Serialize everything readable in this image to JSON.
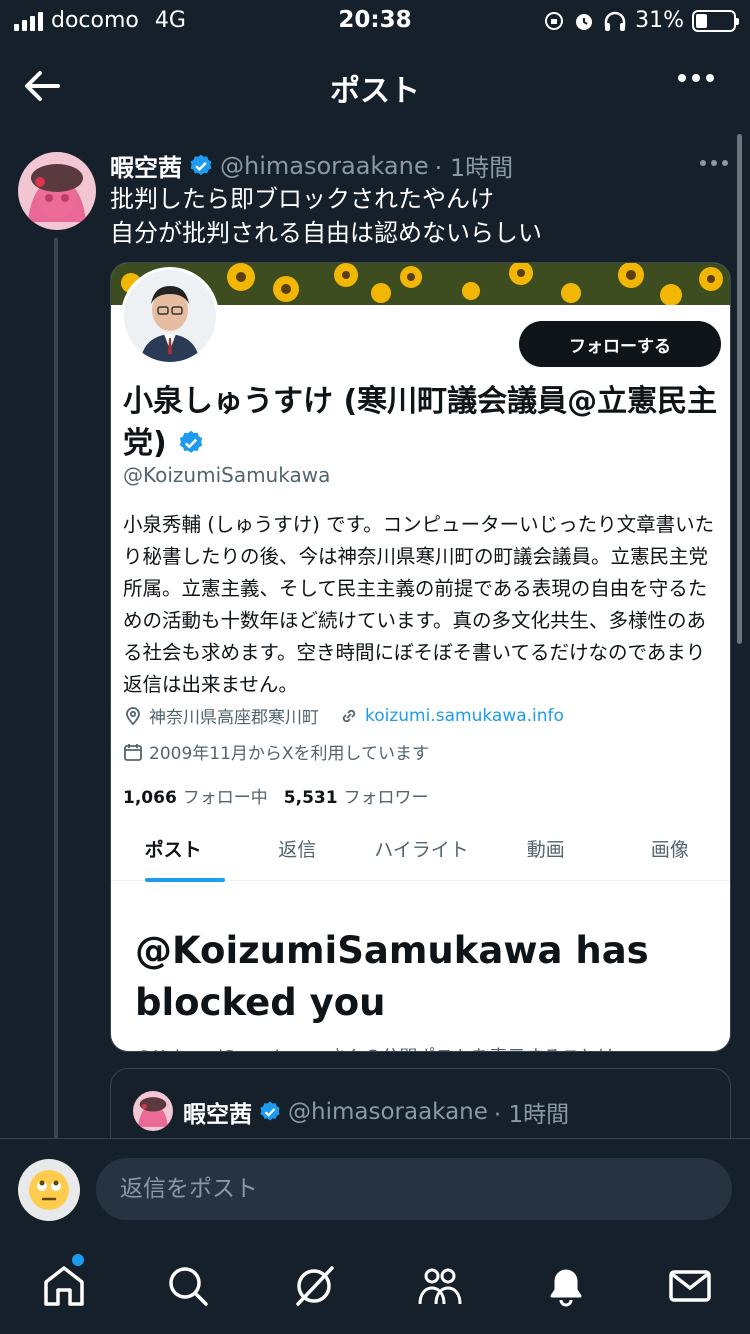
{
  "status_bar": {
    "carrier": "docomo",
    "network": "4G",
    "time": "20:38",
    "battery": "31%"
  },
  "header": {
    "title": "ポスト"
  },
  "tweet": {
    "name": "暇空茜",
    "handle": "@himasoraakane",
    "time": "· 1時間",
    "line1": "批判したら即ブロックされたやんけ",
    "line2": "自分が批判される自由は認めないらしい"
  },
  "embedded_profile": {
    "follow_button": "フォローする",
    "name": "小泉しゅうすけ (寒川町議会議員@立憲民主党)",
    "handle": "@KoizumiSamukawa",
    "bio": "小泉秀輔 (しゅうすけ) です。コンピューターいじったり文章書いたり秘書したりの後、今は神奈川県寒川町の町議会議員。立憲民主党所属。立憲主義、そして民主主義の前提である表現の自由を守るための活動も十数年ほど続けています。真の多文化共生、多様性のある社会も求めます。空き時間にぼそぼそ書いてるだけなのであまり返信は出来ません。",
    "location": "神奈川県高座郡寒川町",
    "link": "koizumi.samukawa.info",
    "joined": "2009年11月からXを利用しています",
    "following_count": "1,066",
    "following_label": "フォロー中",
    "followers_count": "5,531",
    "followers_label": "フォロワー",
    "tabs": [
      "ポスト",
      "返信",
      "ハイライト",
      "動画",
      "画像"
    ],
    "blocked_title": "@KoizumiSamukawa has blocked you",
    "blocked_sub": "@KoizumiSamukawa さんの公開ポストを表示することは"
  },
  "quoted_tweet": {
    "name": "暇空茜",
    "handle": "@himasoraakane",
    "time": "· 1時間"
  },
  "reply": {
    "placeholder": "返信をポスト"
  },
  "colors": {
    "background": "#15202b",
    "accent": "#1d9bf0",
    "muted": "#8b98a5"
  },
  "icons": [
    "back-arrow-icon",
    "more-icon",
    "verified-icon",
    "location-icon",
    "link-icon",
    "calendar-icon",
    "home-icon",
    "search-icon",
    "grok-icon",
    "communities-icon",
    "notifications-icon",
    "messages-icon"
  ]
}
